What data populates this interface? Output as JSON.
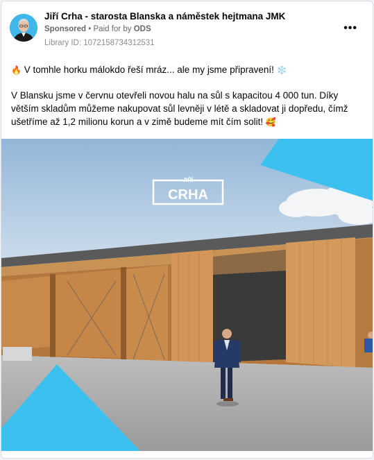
{
  "post": {
    "author": "Jiří Crha - starosta Blanska a náměstek hejtmana JMK",
    "sponsored": "Sponsored",
    "separator": "•",
    "paid_for_prefix": "Paid for by",
    "paid_for_by": "ODS",
    "library_id": "Library ID: 1072158734312531",
    "more_label": "•••",
    "text_line1": "V tomhle horku málokdo řeší mráz... ale my jsme připravení!",
    "text_paragraph2": "V Blansku jsme v červnu otevřeli novou halu na sůl s kapacitou 4 000 tun. Díky větším skladům můžeme nakupovat sůl levněji v létě a skladovat ji dopředu, čímž ušetříme až 1,2 milionu korun a v zimě budeme mít čím solit!",
    "emoji_fire": "🔥",
    "emoji_snowflake": "❄️",
    "emoji_smile": "🥰"
  },
  "image": {
    "logo_top": "JIŘÍ",
    "logo_main": "CRHA"
  },
  "colors": {
    "brand_blue": "#3cc0f0",
    "wood": "#c98a4a",
    "sky": "#b9cfe4"
  },
  "icons": {
    "more": "more-options-icon",
    "avatar": "profile-avatar"
  }
}
